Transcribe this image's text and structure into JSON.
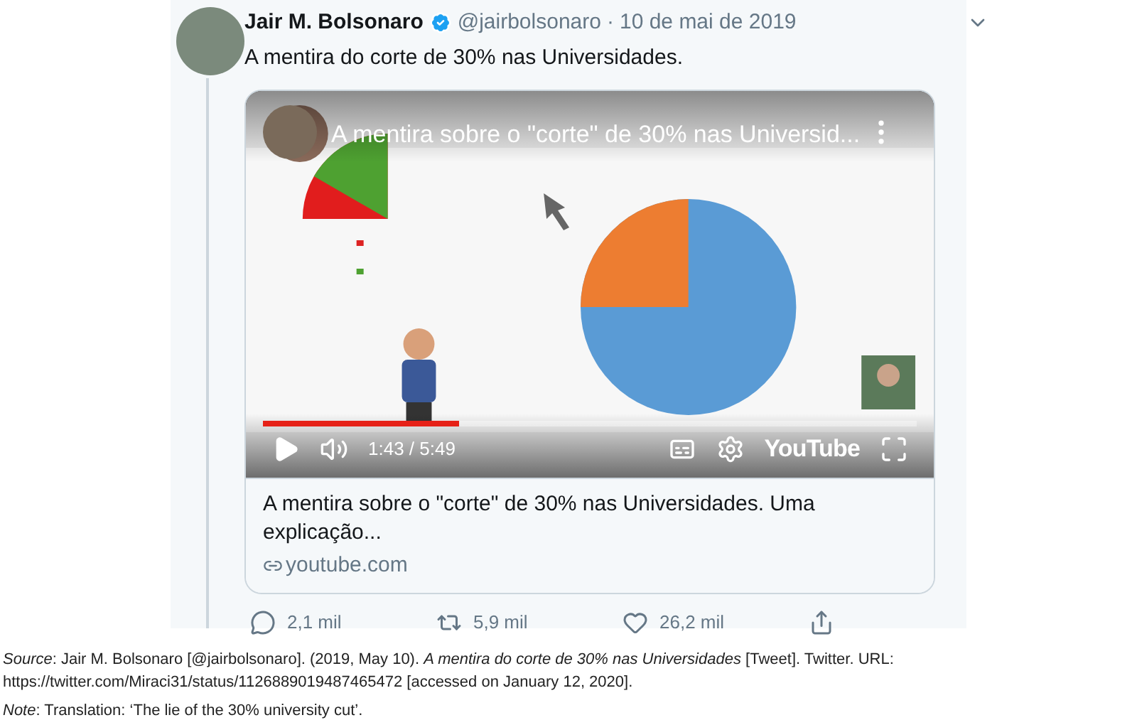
{
  "tweet": {
    "name": "Jair M. Bolsonaro",
    "verified": true,
    "handle": "@jairbolsonaro",
    "separator": "·",
    "date": "10 de mai de 2019",
    "text": "A mentira do corte de 30% nas Universidades.",
    "video": {
      "title": "A mentira sobre o \"corte\" de 30% nas Universid...",
      "time": "1:43 / 5:49",
      "level": 0.3,
      "logo": "YouTube"
    },
    "link_card": {
      "title": "A mentira sobre o \"corte\" de 30% nas Universidades. Uma explicação...",
      "domain": "youtube.com"
    },
    "actions": [
      {
        "kind": "reply",
        "count": "2,1 mil"
      },
      {
        "kind": "retweet",
        "count": "5,9 mil"
      },
      {
        "kind": "like",
        "count": "26,2 mil"
      },
      {
        "kind": "share"
      }
    ]
  },
  "caption": {
    "source": "*Source*: Jair M. Bolsonaro [@jairbolsonaro]. (2019, May 10). *A mentira do corte de 30% nas Universidades* [Tweet]. Twitter. URL: https://twitter.com/Miraci31/status/1126889019487465472 [accessed on January 12, 2020].",
    "note": "*Note*: Translation: ‘The lie of the 30% university cut’."
  }
}
